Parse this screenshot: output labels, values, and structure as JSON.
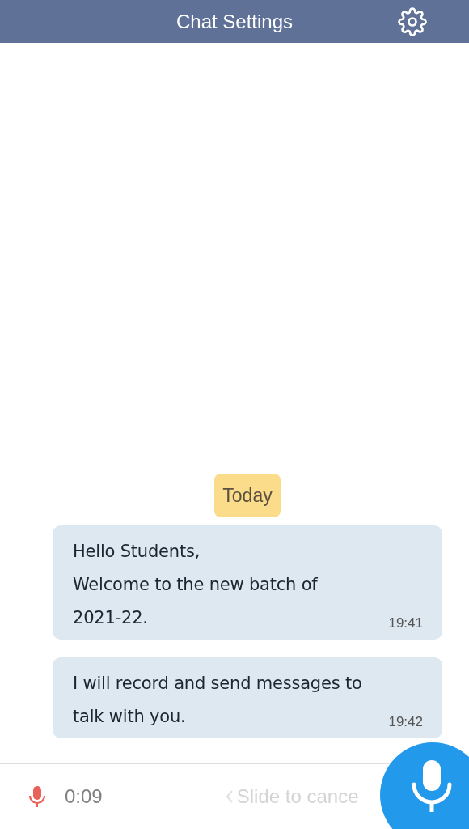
{
  "header": {
    "title": "Chat Settings"
  },
  "date_chip": "Today",
  "messages": [
    {
      "text": "Hello Students,\nWelcome to the new batch of\n2021-22.",
      "time": "19:41"
    },
    {
      "text": "I will record and send messages to\ntalk with you.",
      "time": "19:42"
    }
  ],
  "recorder": {
    "recording": true,
    "duration": "0:09",
    "hint": "Slide to cance"
  }
}
